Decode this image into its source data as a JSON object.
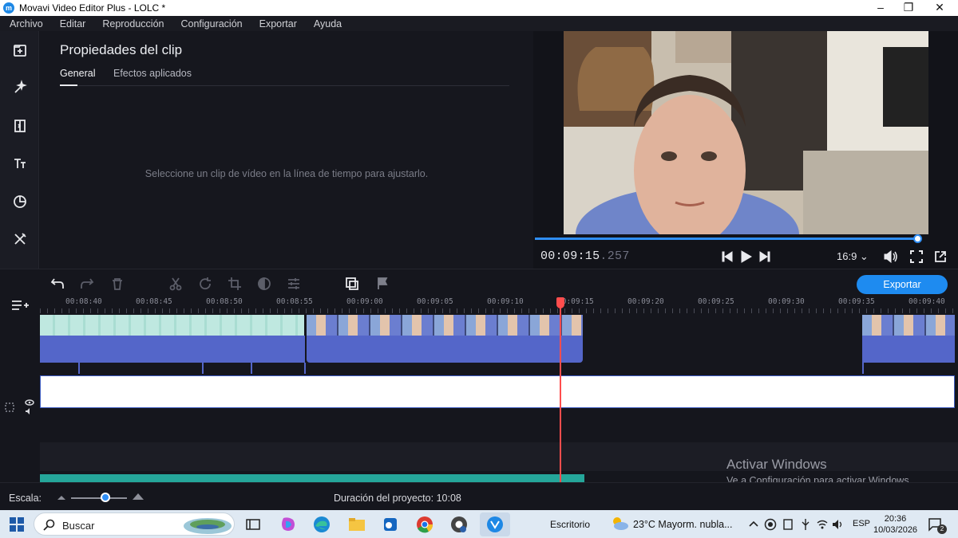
{
  "window": {
    "title": "Movavi Video Editor Plus - LOLC *"
  },
  "menu": [
    "Archivo",
    "Editar",
    "Reproducción",
    "Configuración",
    "Exportar",
    "Ayuda"
  ],
  "left_tools": [
    "import-icon",
    "magic-wand-icon",
    "transition-icon",
    "titles-icon",
    "sticker-icon",
    "tools-icon"
  ],
  "properties": {
    "title": "Propiedades del clip",
    "tabs": [
      "General",
      "Efectos aplicados"
    ],
    "active_tab": "General",
    "hint": "Seleccione un clip de vídeo en la línea de tiempo para ajustarlo."
  },
  "player": {
    "timecode_main": "00:09:15",
    "timecode_ms": ".257",
    "aspect": "16:9",
    "progress": 0.99
  },
  "timeline": {
    "export_label": "Exportar",
    "ruler": [
      "00:08:40",
      "00:08:45",
      "00:08:50",
      "00:08:55",
      "00:09:00",
      "00:09:05",
      "00:09:10",
      "00:09:15",
      "00:09:20",
      "00:09:25",
      "00:09:30",
      "00:09:35",
      "00:09:40"
    ],
    "playhead_time": "00:09:15"
  },
  "watermark": {
    "line1": "Activar Windows",
    "line2": "Ve a Configuración para activar Windows."
  },
  "status": {
    "scale_label": "Escala:",
    "duration_label": "Duración del proyecto:",
    "duration_value": "10:08"
  },
  "taskbar": {
    "search_label": "Buscar",
    "desktop_label": "Escritorio",
    "weather": "23°C  Mayorm. nubla...",
    "lang": "ESP",
    "time": "20:36",
    "date": "10/03/2026",
    "notifications": "2"
  },
  "colors": {
    "accent": "#1e8bf0",
    "playhead": "#ff4d4d",
    "audio": "#5466c9",
    "music": "#25a69a"
  }
}
